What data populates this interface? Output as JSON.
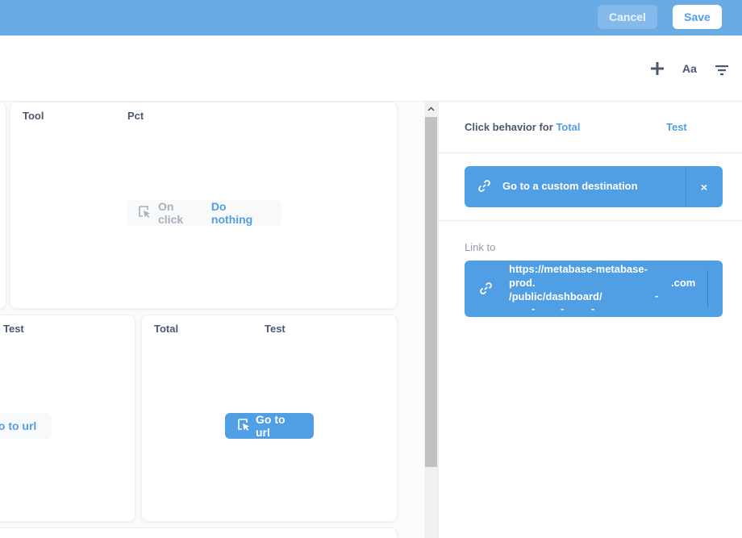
{
  "header": {
    "cancel_label": "Cancel",
    "save_label": "Save",
    "colors": {
      "bar": "#6aabe6",
      "accent": "#509ee3"
    }
  },
  "toolbar": {
    "add_icon": "plus-icon",
    "text_label": "Aa",
    "filter_icon": "filter-icon"
  },
  "cards": [
    {
      "col1": "Tool",
      "col2": "Pct",
      "on_click_label": "On click",
      "on_click_value": "Do nothing"
    },
    {
      "col1": "Test",
      "action_label": "Go to url"
    },
    {
      "col1": "Total",
      "col2": "Test",
      "action_label": "Go to url"
    }
  ],
  "sidebar": {
    "title_prefix": "Click behavior for",
    "title_column": "Total",
    "title_extra": "Test",
    "destination_label": "Go to a custom destination",
    "close_label": "×",
    "link_to_label": "Link to",
    "link_url_line1": "https://metabase-metabase-",
    "link_url_line2": "prod.",
    "link_url_line3": "/public/dashboard/",
    "link_url_com": ".com",
    "link_url_dash": "-"
  }
}
